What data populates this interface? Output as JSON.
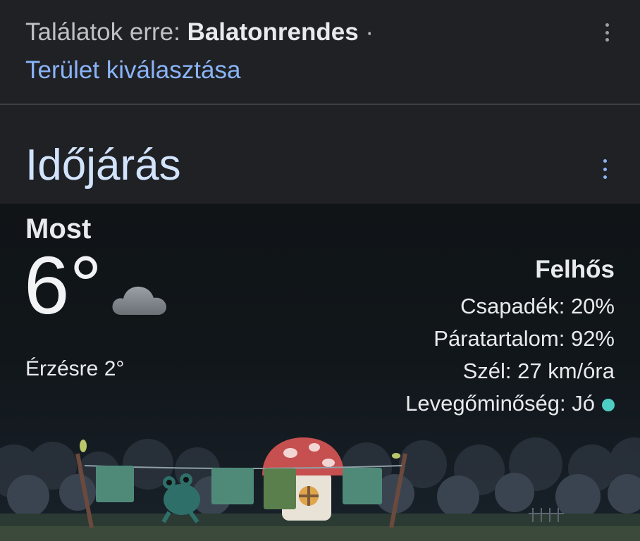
{
  "search": {
    "results_prefix": "Találatok erre:",
    "place": "Balatonrendes",
    "separator": "·",
    "area_link": "Terület kiválasztása"
  },
  "weather": {
    "title": "Időjárás",
    "now_label": "Most",
    "temperature": "6°",
    "icon": "cloud-icon",
    "feels_like": "Érzésre 2°",
    "condition": "Felhős",
    "precipitation": "Csapadék: 20%",
    "humidity": "Páratartalom: 92%",
    "wind": "Szél: 27 km/óra",
    "air_quality": "Levegőminőség: Jó",
    "air_quality_color": "#4ecdc4"
  },
  "colors": {
    "background": "#202124",
    "link": "#8ab4f8",
    "title": "#d2e3fc"
  }
}
